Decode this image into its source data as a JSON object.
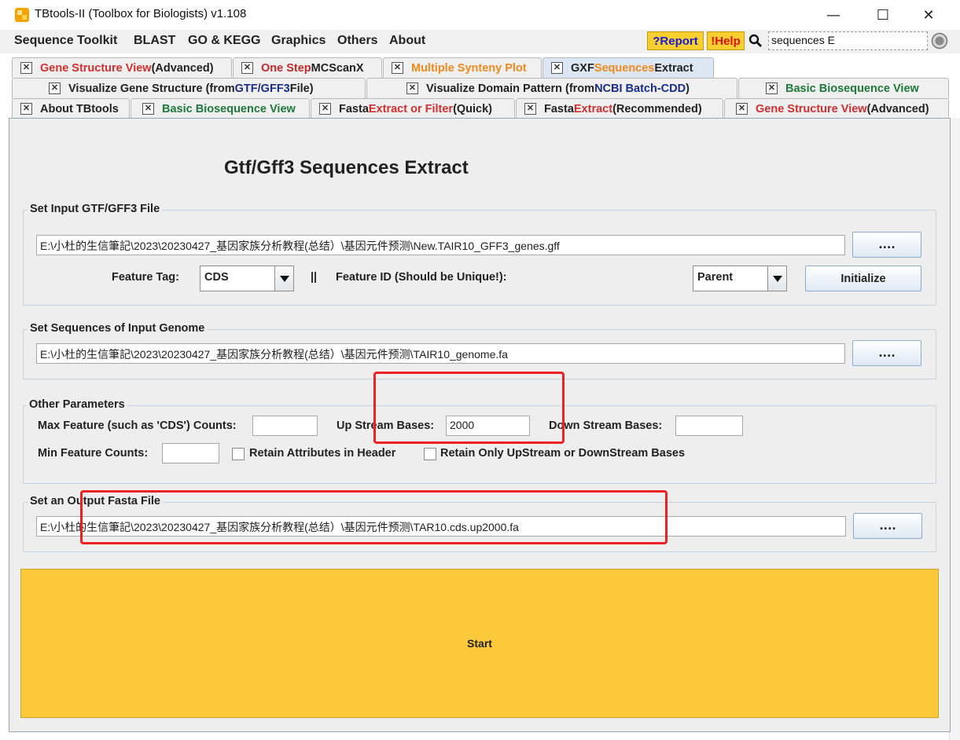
{
  "window": {
    "title": "TBtools-II (Toolbox for Biologists) v1.108",
    "minimize": "—",
    "maximize": "☐",
    "close": "✕"
  },
  "menu": {
    "items": [
      "Sequence Toolkit",
      "BLAST",
      "GO & KEGG",
      "Graphics",
      "Others",
      "About"
    ],
    "report": "?Report",
    "help": "!Help",
    "search_value": "sequences E"
  },
  "tabs": {
    "row1": [
      {
        "parts": [
          "Gene Structure View",
          " (Advanced)"
        ]
      },
      {
        "parts": [
          "One Step",
          " MCScanX"
        ]
      },
      {
        "parts": [
          "Multiple Synteny Plot"
        ]
      },
      {
        "parts": [
          "GXF ",
          "Sequences",
          " Extract"
        ]
      }
    ],
    "row2": [
      {
        "parts": [
          "Visualize Gene Structure (from ",
          "GTF/GFF3",
          " File)"
        ]
      },
      {
        "parts": [
          "Visualize Domain Pattern (from ",
          "NCBI Batch-CDD",
          ")"
        ]
      },
      {
        "parts": [
          "Basic Biosequence View"
        ]
      }
    ],
    "row3": [
      {
        "parts": [
          "About TBtools"
        ]
      },
      {
        "parts": [
          "Basic Biosequence View"
        ]
      },
      {
        "parts": [
          "Fasta ",
          "Extract or Filter",
          " (Quick)"
        ]
      },
      {
        "parts": [
          "Fasta ",
          "Extract",
          " (Recommended)"
        ]
      },
      {
        "parts": [
          "Gene Structure View",
          " (Advanced)"
        ]
      }
    ]
  },
  "panel": {
    "title": "Gtf/Gff3 Sequences Extract",
    "input_group": {
      "label": "Set Input GTF/GFF3 File",
      "file_path": "E:\\小杜的生信筆記\\2023\\20230427_基因家族分析教程(总结）\\基因元件预测\\New.TAIR10_GFF3_genes.gff",
      "browse": "....",
      "feature_tag_label": "Feature Tag:",
      "feature_tag_value": "CDS",
      "separator": "||",
      "feature_id_label": "Feature ID (Should be Unique!):",
      "feature_id_value": "Parent",
      "initialize": "Initialize"
    },
    "genome_group": {
      "label": "Set Sequences of Input Genome",
      "file_path": "E:\\小杜的生信筆記\\2023\\20230427_基因家族分析教程(总结）\\基因元件预测\\TAIR10_genome.fa",
      "browse": "...."
    },
    "params_group": {
      "label": "Other Parameters",
      "max_feature_label": "Max Feature (such as 'CDS') Counts:",
      "max_feature_value": "",
      "up_stream_label": "Up Stream Bases:",
      "up_stream_value": "2000",
      "down_stream_label": "Down Stream Bases:",
      "down_stream_value": "",
      "min_feature_label": "Min Feature Counts:",
      "min_feature_value": "",
      "retain_attr_label": "Retain Attributes in Header",
      "retain_only_label": "Retain Only UpStream or DownStream Bases"
    },
    "output_group": {
      "label": "Set an Output Fasta File",
      "file_path": "E:\\小杜的生信筆記\\2023\\20230427_基因家族分析教程(总结）\\基因元件预测\\TAR10.cds.up2000.fa",
      "browse": "...."
    },
    "start": "Start"
  },
  "colors": {
    "accent_yellow": "#fcc93a",
    "highlight_red": "#ee2222",
    "tab_red": "#d32f2f",
    "tab_green": "#1e7a3a",
    "tab_orange": "#f08a1c",
    "tab_blue": "#1a2d8f"
  }
}
